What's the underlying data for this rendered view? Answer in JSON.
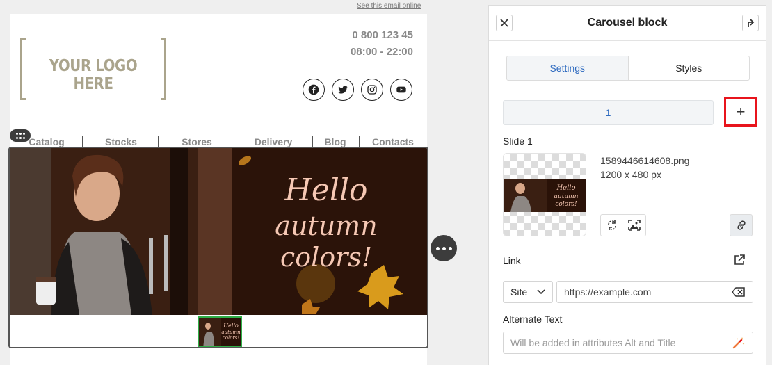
{
  "email": {
    "see_online_link": "See this email online",
    "logo_text": "YOUR LOGO HERE",
    "phone": "0 800 123 45",
    "hours": "08:00 - 22:00",
    "socials": [
      "facebook-icon",
      "twitter-icon",
      "instagram-icon",
      "youtube-icon"
    ],
    "nav": [
      "Catalog",
      "Stocks",
      "Stores",
      "Delivery",
      "Blog",
      "Contacts"
    ],
    "banner": {
      "headline_line1": "Hello",
      "headline_line2": "autumn",
      "headline_line3": "colors!",
      "headline_color": "#f6c8b4",
      "background_color": "#2a1208"
    }
  },
  "panel": {
    "title": "Carousel block",
    "tabs": [
      {
        "label": "Settings",
        "active": true
      },
      {
        "label": "Styles",
        "active": false
      }
    ],
    "slide_tab_label": "1",
    "add_slide_label": "+",
    "slide_label": "Slide 1",
    "file_name": "1589446614608.png",
    "file_size": "1200 x 480 px",
    "link_label": "Link",
    "link_type": "Site",
    "link_value": "https://example.com",
    "alt_label": "Alternate Text",
    "alt_placeholder": "Will be added in attributes Alt and Title"
  },
  "colors": {
    "accent_blue": "#2f6bc0",
    "highlight_red": "#e8141c",
    "thumb_selected_green": "#2fae47",
    "logo_gray": "#aaa48c"
  }
}
